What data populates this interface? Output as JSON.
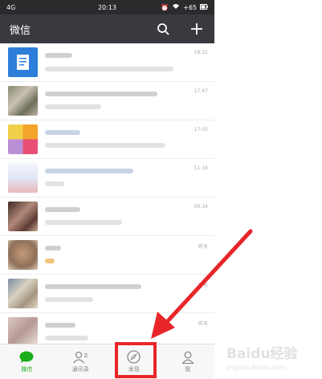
{
  "status_bar": {
    "network": "4G",
    "time": "20:13",
    "battery": "+65"
  },
  "header": {
    "title": "微信",
    "search_icon": "search-icon",
    "add_icon": "plus-icon"
  },
  "chats": [
    {
      "time": "18:31"
    },
    {
      "time": "17:47"
    },
    {
      "time": "17:02"
    },
    {
      "time": "11:16"
    },
    {
      "time": "00:34"
    },
    {
      "time": "昨天"
    },
    {
      "time": "昨天"
    },
    {
      "time": "昨天"
    }
  ],
  "tabs": [
    {
      "label": "微信",
      "icon": "chat-icon",
      "active": true
    },
    {
      "label": "通讯录",
      "icon": "contacts-icon",
      "active": false
    },
    {
      "label": "发现",
      "icon": "compass-icon",
      "active": false
    },
    {
      "label": "我",
      "icon": "person-icon",
      "active": false
    }
  ],
  "colors": {
    "header_bg": "#393a3f",
    "status_bg": "#2b2b2e",
    "accent_green": "#1aad19",
    "annotation_red": "#e8262a"
  },
  "watermark": {
    "logo": "Baidu经验",
    "sub": "jingyan.baidu.com"
  }
}
